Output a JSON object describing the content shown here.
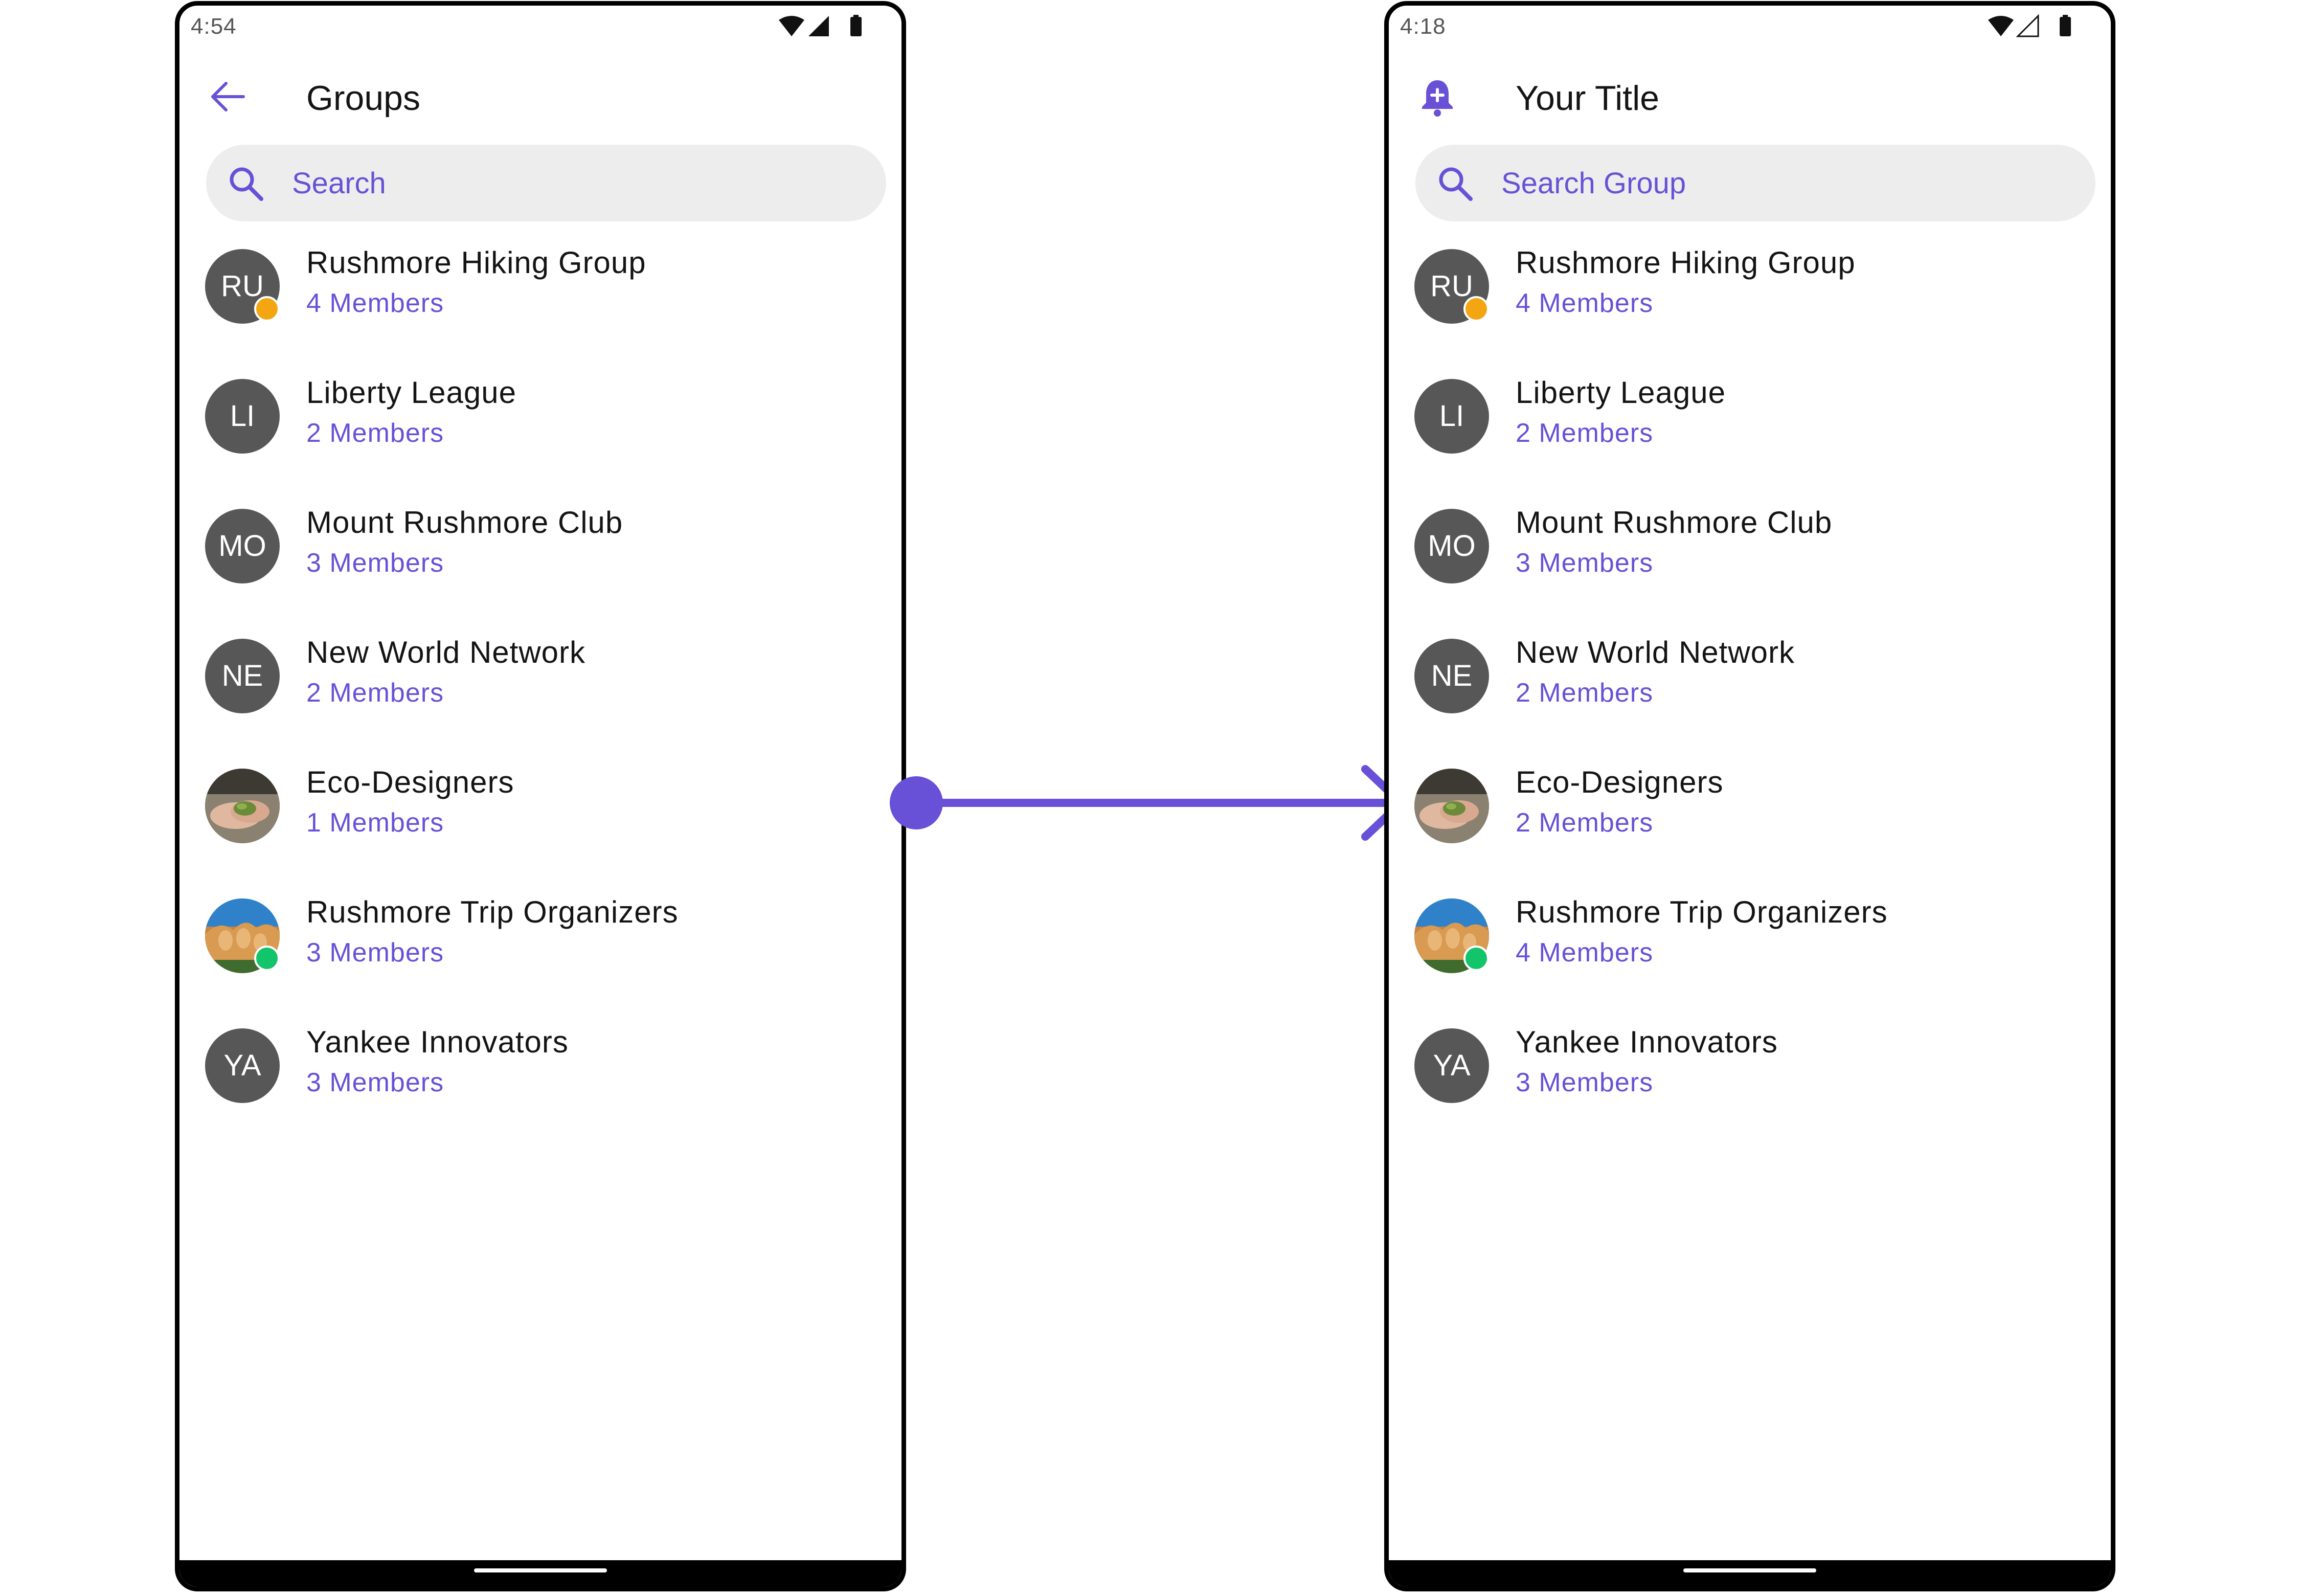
{
  "colors": {
    "accent": "#6851d6",
    "avatar_bg": "#575757",
    "search_bg": "#ededed",
    "lock_badge": "#f4a512",
    "password_badge": "#12c46a"
  },
  "left": {
    "status_time": "4:54",
    "header_icon": "arrow-back-icon",
    "title": "Groups",
    "search_placeholder": "Search",
    "groups": [
      {
        "initials": "RU",
        "name": "Rushmore Hiking Group",
        "members": "4 Members",
        "badge": "lock"
      },
      {
        "initials": "LI",
        "name": "Liberty League",
        "members": "2 Members"
      },
      {
        "initials": "MO",
        "name": "Mount Rushmore Club",
        "members": "3 Members"
      },
      {
        "initials": "NE",
        "name": "New World Network",
        "members": "2 Members"
      },
      {
        "initials": "",
        "name": "Eco-Designers",
        "members": "1 Members",
        "image": "hands-with-plant-photo"
      },
      {
        "initials": "",
        "name": "Rushmore Trip Organizers",
        "members": "3 Members",
        "image": "mount-rushmore-photo",
        "badge": "password"
      },
      {
        "initials": "YA",
        "name": "Yankee Innovators",
        "members": "3 Members"
      }
    ]
  },
  "right": {
    "status_time": "4:18",
    "header_icon": "notification-add-icon",
    "title": "Your Title",
    "search_placeholder": "Search Group",
    "groups": [
      {
        "initials": "RU",
        "name": "Rushmore Hiking Group",
        "members": "4 Members",
        "badge": "lock"
      },
      {
        "initials": "LI",
        "name": "Liberty League",
        "members": "2 Members"
      },
      {
        "initials": "MO",
        "name": "Mount Rushmore Club",
        "members": "3 Members"
      },
      {
        "initials": "NE",
        "name": "New World Network",
        "members": "2 Members"
      },
      {
        "initials": "",
        "name": "Eco-Designers",
        "members": "2 Members",
        "image": "hands-with-plant-photo"
      },
      {
        "initials": "",
        "name": "Rushmore Trip Organizers",
        "members": "4 Members",
        "image": "mount-rushmore-photo",
        "badge": "password"
      },
      {
        "initials": "YA",
        "name": "Yankee Innovators",
        "members": "3 Members"
      }
    ]
  }
}
